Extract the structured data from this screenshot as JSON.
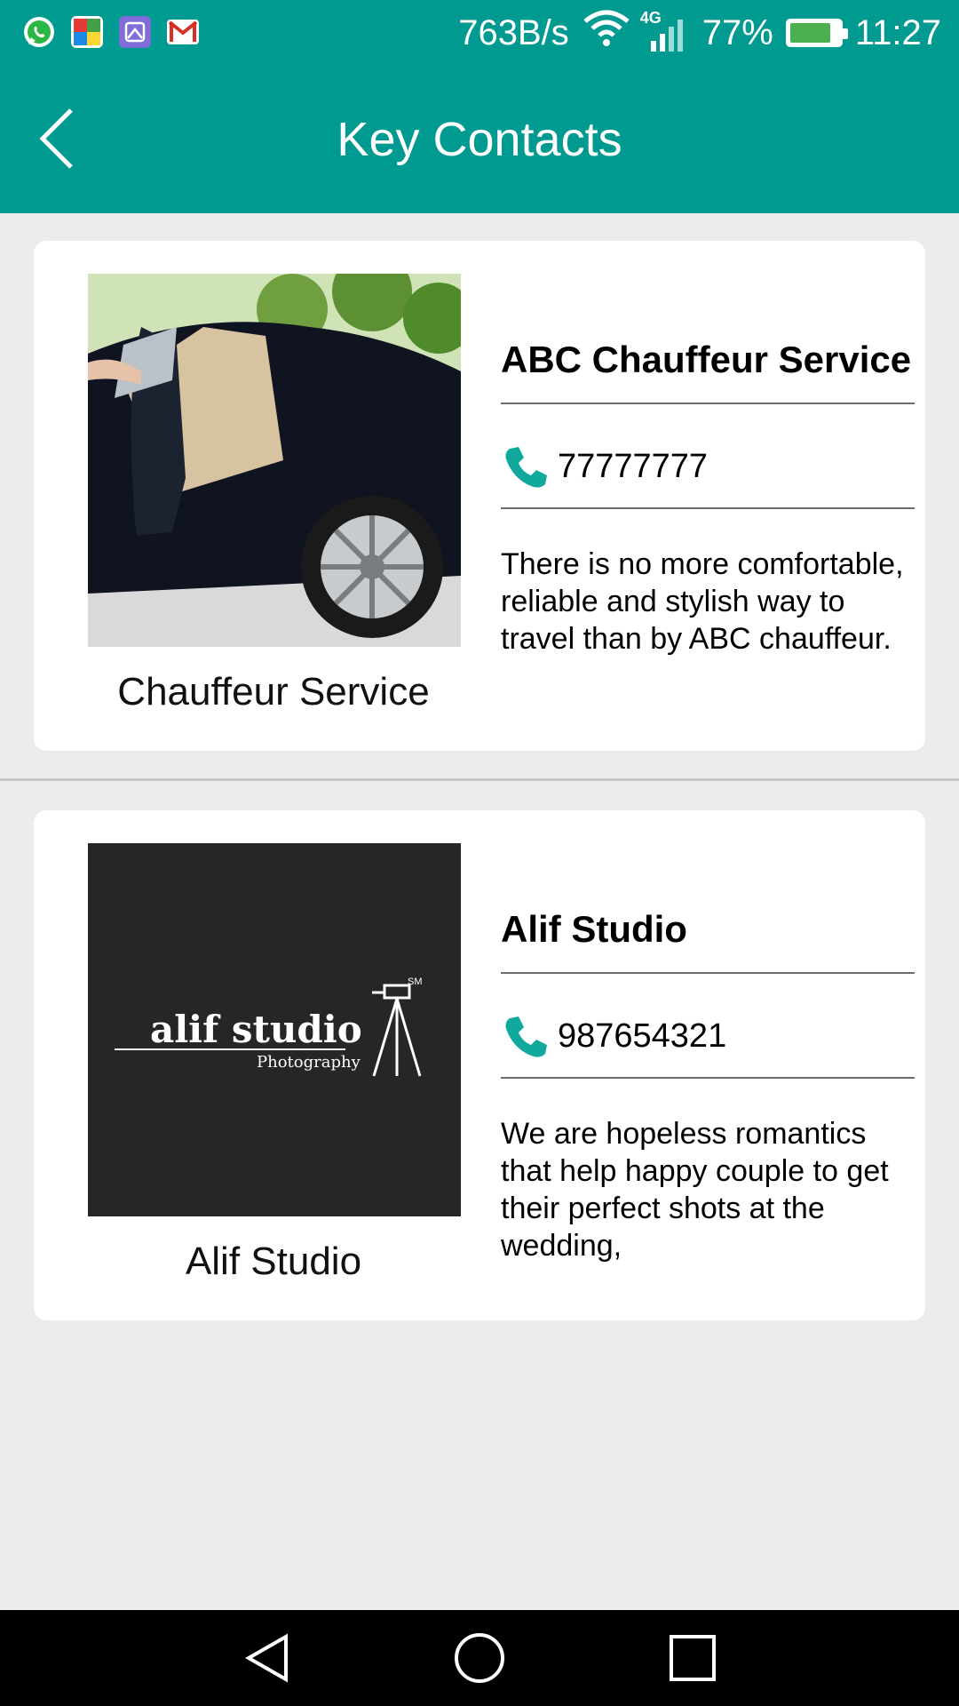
{
  "status_bar": {
    "notification_icons": [
      "whatsapp-icon",
      "puzzle-app-icon",
      "gallery-app-icon",
      "gmail-icon"
    ],
    "net_speed": "763B/s",
    "network_type": "4G",
    "battery_percent": "77%",
    "battery_level": 0.77,
    "time": "11:27"
  },
  "header": {
    "title": "Key Contacts"
  },
  "contacts": [
    {
      "image_caption": "Chauffeur Service",
      "name": "ABC Chauffeur Service",
      "phone": "77777777",
      "description": "There is no more comfortable, reliable and stylish way to travel than by ABC chauffeur."
    },
    {
      "image_caption": "Alif Studio",
      "logo_text": "alif studio",
      "logo_subtext": "Photography",
      "logo_mark": "SM",
      "name": "Alif Studio",
      "phone": "987654321",
      "description": "We are hopeless romantics that help happy couple to get their perfect shots at the wedding,"
    }
  ],
  "colors": {
    "primary": "#009a90",
    "phone_icon": "#11a99d",
    "background": "#ececec"
  }
}
